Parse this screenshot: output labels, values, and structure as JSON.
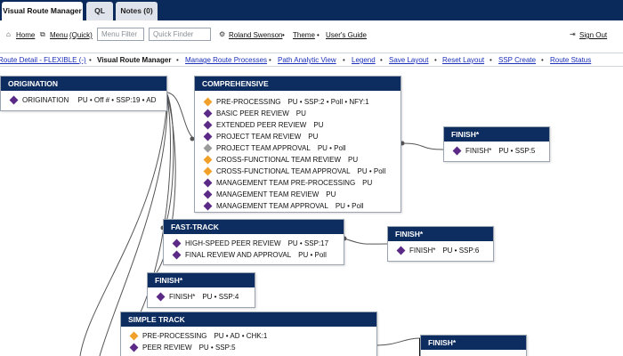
{
  "tabs": [
    {
      "label": "Visual Route Manager"
    },
    {
      "label": "QL"
    },
    {
      "label": "Notes (0)"
    }
  ],
  "toolbar": {
    "home": "Home",
    "menu": "Menu",
    "quick": "(Quick)",
    "menu_filter_placeholder": "Menu Filter",
    "quick_finder_placeholder": "Quick Finder",
    "user": "Roland Swenson",
    "theme": "Theme",
    "guide": "User's Guide",
    "signout": "Sign Out"
  },
  "nav": {
    "route_detail": "Route Detail - FLEXIBLE (-)",
    "current": "Visual Route Manager",
    "manage": "Manage Route Processes",
    "path": "Path Analytic View",
    "legend": "Legend",
    "save": "Save Layout",
    "reset": "Reset Layout",
    "ssp": "SSP Create",
    "status": "Route Status"
  },
  "colors": {
    "header": "#0d2c5f",
    "purple": "#5b2a86",
    "orange": "#f1a02a",
    "gray": "#9a9a9a",
    "link": "#1b2fb8"
  },
  "icons": {
    "home": "home-icon",
    "menu": "menu-icon",
    "gear": "gear-icon",
    "signout": "sign-out-icon",
    "diamond": "diamond-icon"
  },
  "boxes": {
    "origination": {
      "title": "ORIGINATION",
      "rows": [
        {
          "name": "ORIGINATION",
          "meta": "PU • Off # • SSP:19 • AD",
          "color": "purple"
        }
      ]
    },
    "comprehensive": {
      "title": "COMPREHENSIVE",
      "rows": [
        {
          "name": "PRE-PROCESSING",
          "meta": "PU • SSP:2 • Poll • NFY:1",
          "color": "orange"
        },
        {
          "name": "BASIC PEER REVIEW",
          "meta": "PU",
          "color": "purple"
        },
        {
          "name": "EXTENDED PEER REVIEW",
          "meta": "PU",
          "color": "purple"
        },
        {
          "name": "PROJECT TEAM REVIEW",
          "meta": "PU",
          "color": "purple"
        },
        {
          "name": "PROJECT TEAM APPROVAL",
          "meta": "PU • Poll",
          "color": "gray"
        },
        {
          "name": "CROSS-FUNCTIONAL TEAM REVIEW",
          "meta": "PU",
          "color": "orange"
        },
        {
          "name": "CROSS-FUNCTIONAL TEAM APPROVAL",
          "meta": "PU • Poll",
          "color": "orange"
        },
        {
          "name": "MANAGEMENT TEAM PRE-PROCESSING",
          "meta": "PU",
          "color": "purple"
        },
        {
          "name": "MANAGEMENT TEAM REVIEW",
          "meta": "PU",
          "color": "purple"
        },
        {
          "name": "MANAGEMENT TEAM APPROVAL",
          "meta": "PU • Poll",
          "color": "purple"
        }
      ]
    },
    "finish1": {
      "title": "FINISH*",
      "rows": [
        {
          "name": "FINISH*",
          "meta": "PU • SSP:5",
          "color": "purple"
        }
      ]
    },
    "fasttrack": {
      "title": "FAST-TRACK",
      "rows": [
        {
          "name": "HIGH-SPEED PEER REVIEW",
          "meta": "PU • SSP:17",
          "color": "purple"
        },
        {
          "name": "FINAL REVIEW AND APPROVAL",
          "meta": "PU • Poll",
          "color": "purple"
        }
      ]
    },
    "finish2": {
      "title": "FINISH*",
      "rows": [
        {
          "name": "FINISH*",
          "meta": "PU • SSP:6",
          "color": "purple"
        }
      ]
    },
    "finish3": {
      "title": "FINISH*",
      "rows": [
        {
          "name": "FINISH*",
          "meta": "PU • SSP:4",
          "color": "purple"
        }
      ]
    },
    "simpletrack": {
      "title": "SIMPLE TRACK",
      "rows": [
        {
          "name": "PRE-PROCESSING",
          "meta": "PU • AD • CHK:1",
          "color": "orange"
        },
        {
          "name": "PEER REVIEW",
          "meta": "PU • SSP:5",
          "color": "purple"
        }
      ]
    },
    "finish4": {
      "title": "FINISH*",
      "rows": []
    }
  }
}
